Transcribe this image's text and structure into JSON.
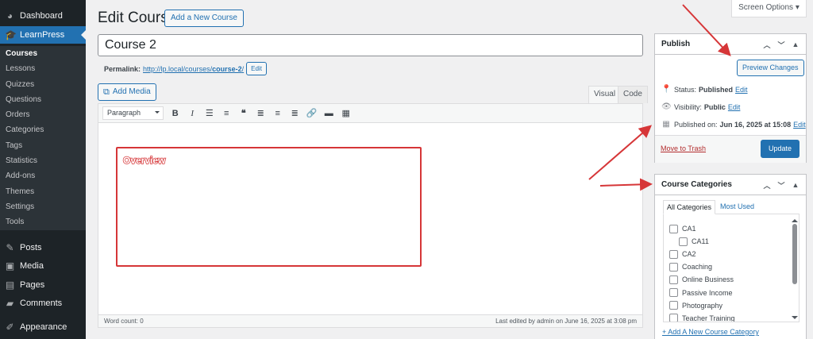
{
  "sidebar": {
    "dashboard": "Dashboard",
    "learnpress": "LearnPress",
    "submenu": [
      "Courses",
      "Lessons",
      "Quizzes",
      "Questions",
      "Orders",
      "Categories",
      "Tags",
      "Statistics",
      "Add-ons",
      "Themes",
      "Settings",
      "Tools"
    ],
    "lower": [
      "Posts",
      "Media",
      "Pages",
      "Comments",
      "Appearance"
    ]
  },
  "header": {
    "title": "Edit Course",
    "add_new": "Add a New Course",
    "screen_options": "Screen Options ▾"
  },
  "post": {
    "title": "Course 2",
    "permalink_label": "Permalink:",
    "permalink_base": "http://lp.local/courses/",
    "permalink_slug": "course-2",
    "permalink_end": "/",
    "permalink_edit": "Edit"
  },
  "editor": {
    "add_media": "Add Media",
    "tab_visual": "Visual",
    "tab_code": "Code",
    "format": "Paragraph",
    "annotation": "Overview",
    "word_count": "Word count: 0",
    "last_edited": "Last edited by admin on June 16, 2025 at 3:08 pm"
  },
  "publish": {
    "title": "Publish",
    "preview": "Preview Changes",
    "status_label": "Status:",
    "status_value": "Published",
    "visibility_label": "Visibility:",
    "visibility_value": "Public",
    "published_label": "Published on:",
    "published_value": "Jun 16, 2025 at 15:08",
    "edit": "Edit",
    "trash": "Move to Trash",
    "update": "Update"
  },
  "categories": {
    "title": "Course Categories",
    "tab_all": "All Categories",
    "tab_used": "Most Used",
    "items": [
      {
        "name": "CA1",
        "child": false
      },
      {
        "name": "CA11",
        "child": true
      },
      {
        "name": "CA2",
        "child": false
      },
      {
        "name": "Coaching",
        "child": false
      },
      {
        "name": "Online Business",
        "child": false
      },
      {
        "name": "Passive Income",
        "child": false
      },
      {
        "name": "Photography",
        "child": false
      },
      {
        "name": "Teacher Training",
        "child": false
      }
    ],
    "add_link": "+ Add A New Course Category"
  },
  "colors": {
    "admin_bar": "#1d2327",
    "accent": "#2271b1",
    "annotation": "#d63638"
  }
}
